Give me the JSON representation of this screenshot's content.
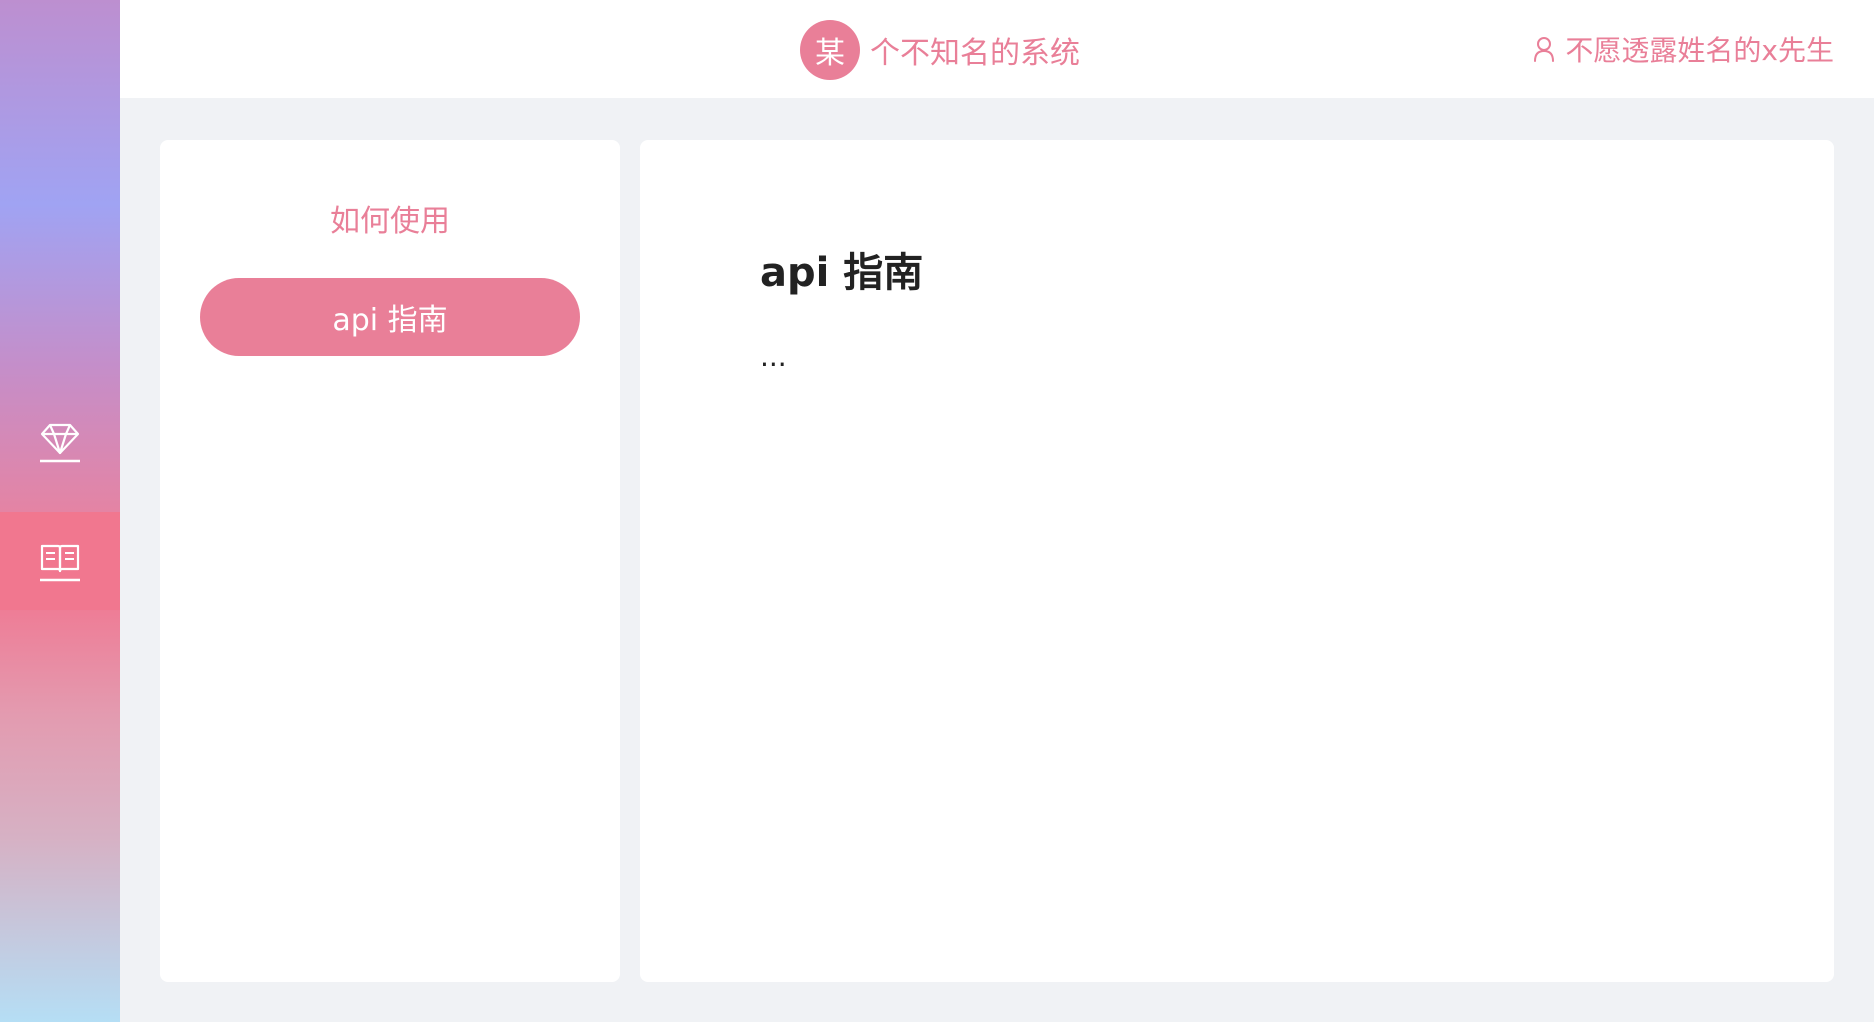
{
  "header": {
    "logo_char": "某",
    "app_title": "个不知名的系统",
    "username": "不愿透露姓名的x先生"
  },
  "rail": {
    "items": [
      {
        "icon": "diamond-icon",
        "active": false
      },
      {
        "icon": "book-icon",
        "active": true
      }
    ]
  },
  "sidebar": {
    "title": "如何使用",
    "items": [
      {
        "label": "api 指南",
        "active": true
      }
    ]
  },
  "main": {
    "heading": "api 指南",
    "body": "..."
  },
  "colors": {
    "accent": "#e97f98",
    "rail_active": "#f1778f",
    "background": "#f0f2f5"
  }
}
